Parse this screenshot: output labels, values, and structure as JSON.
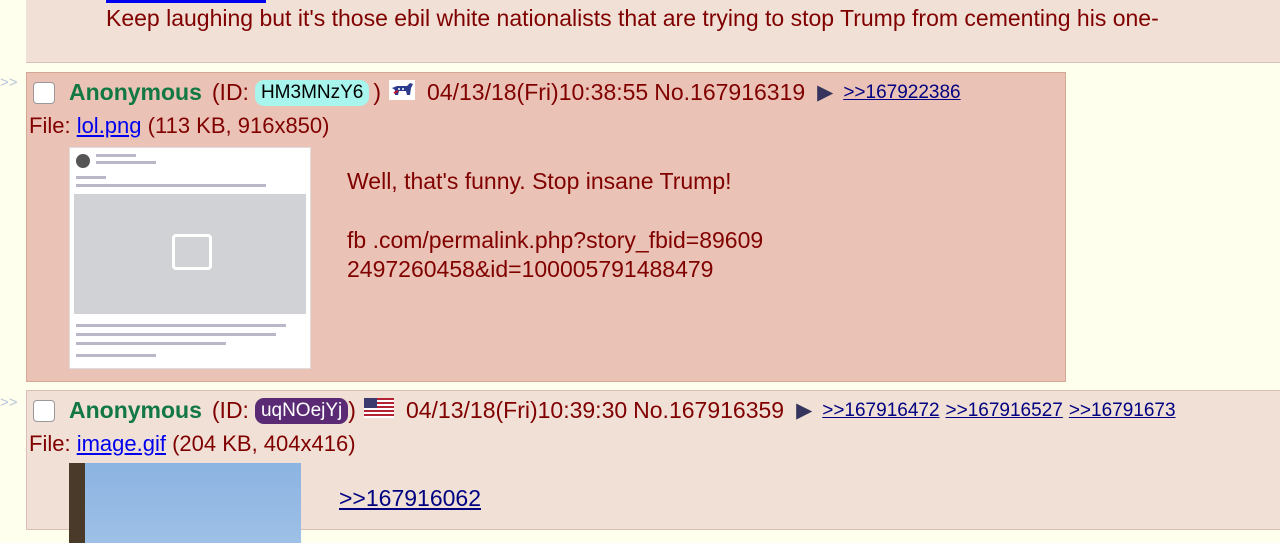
{
  "previous_post": {
    "comment": "Keep laughing but it's those ebil white nationalists that are trying to stop Trump from cementing his one-"
  },
  "side_arrow": ">>",
  "posts": [
    {
      "name": "Anonymous",
      "id_prefix": "(ID:",
      "poster_id": "HM3MNzY6",
      "id_suffix": ")",
      "flag_icon": "democrat-donkey-flag-icon",
      "datetime": "04/13/18(Fri)10:38:55",
      "post_no": "No.167916319",
      "backlinks": [
        ">>167922386"
      ],
      "file_label": "File:",
      "file_name": "lol.png",
      "file_info": "(113 KB, 916x850)",
      "comment_line1": "Well, that's funny. Stop insane Trump!",
      "comment_line2": "fb .com/permalink.php?story_fbid=89609",
      "comment_line3": "2497260458&id=100005791488479",
      "id_color": "#a7f5ed"
    },
    {
      "name": "Anonymous",
      "id_prefix": "(ID:",
      "poster_id": "uqNOejYj",
      "id_suffix": ")",
      "flag_icon": "us-flag-icon",
      "datetime": "04/13/18(Fri)10:39:30",
      "post_no": "No.167916359",
      "backlinks": [
        ">>167916472",
        ">>167916527",
        ">>16791673"
      ],
      "file_label": "File:",
      "file_name": "image.gif",
      "file_info": "(204 KB, 404x416)",
      "quote_link": ">>167916062",
      "id_color": "#5a2a74"
    }
  ],
  "colors": {
    "page_bg": "#ffffee",
    "post_bg": "#f0e0d6",
    "highlighted_post_bg": "#eac3b6",
    "name": "#117743",
    "text": "#800000"
  }
}
